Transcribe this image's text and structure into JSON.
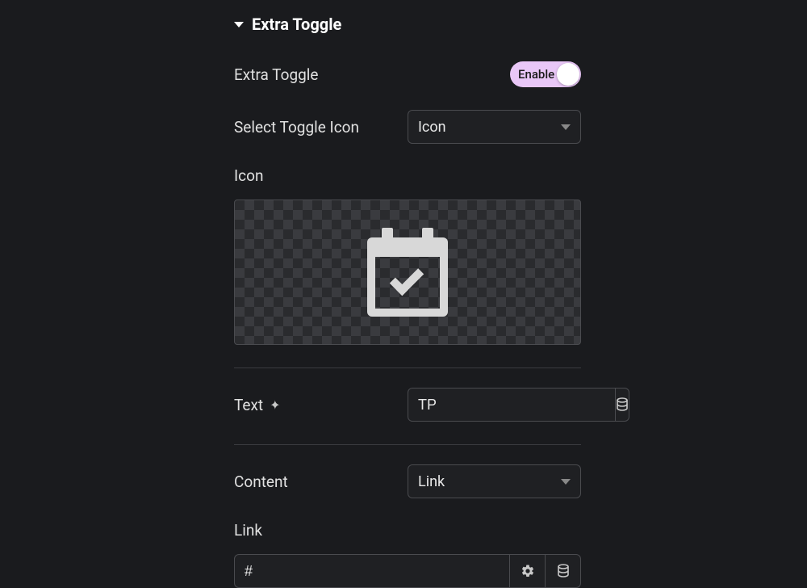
{
  "section": {
    "title": "Extra Toggle"
  },
  "toggle": {
    "label": "Extra Toggle",
    "state_label": "Enable"
  },
  "select_icon": {
    "label": "Select Toggle Icon",
    "value": "Icon"
  },
  "icon_field": {
    "label": "Icon"
  },
  "text_field": {
    "label": "Text",
    "value": "TP"
  },
  "content_field": {
    "label": "Content",
    "value": "Link"
  },
  "link_field": {
    "label": "Link",
    "value": "#"
  }
}
